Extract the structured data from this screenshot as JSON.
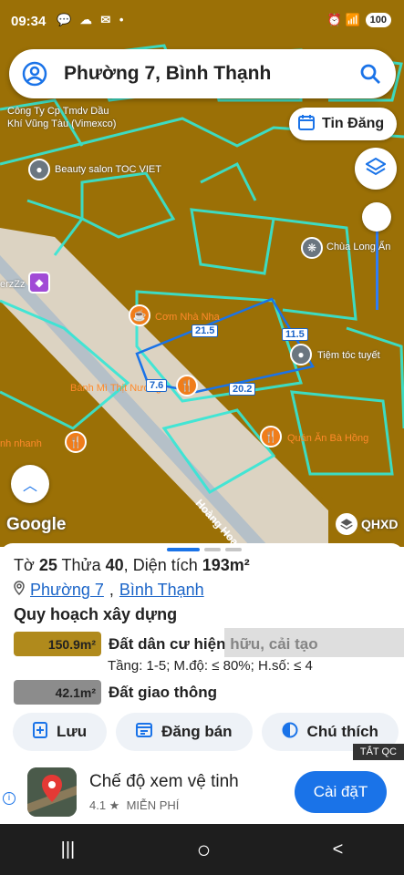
{
  "status": {
    "time": "09:34",
    "icons": "💬 ☁ ✉ •",
    "right_icons": "⏰ 📶",
    "battery": "100"
  },
  "search": {
    "title": "Phường 7, Bình Thạnh"
  },
  "map": {
    "tin_dang_label": "Tin Đăng",
    "pois": {
      "cong_ty_line1": "Công Ty Cp Tmdv Dầu",
      "cong_ty_line2": "Khí Vũng Tàu (Vimexco)",
      "beauty_salon": "Beauty salon TOC VIET",
      "chua_long_an": "Chùa Long Ẩn",
      "zerz": "erzZz",
      "com_nha": "Cơm Nhà Nha",
      "toc_tuyet": "Tiệm tóc tuyết",
      "banh_mi": "Bánh Mì Thịt Nướng",
      "nhanh": "nh nhanh",
      "quan_an": "Quán Ăn Bà Hồng"
    },
    "dimensions": {
      "d1": "21.5",
      "d2": "11.5",
      "d3": "20.2",
      "d4": "7.6"
    },
    "road_name": "Hoàng Hoa Thám",
    "google_logo": "Google",
    "qhxd_label": "QHXD"
  },
  "parcel": {
    "to_label": "Tờ",
    "to_value": "25",
    "thua_label": "Thửa",
    "thua_value": "40",
    "area_label": "Diện tích",
    "area_value": "193m²"
  },
  "place": {
    "ward": "Phường 7",
    "district": "Bình Thạnh",
    "separator": ","
  },
  "zoning": {
    "title": "Quy hoạch xây dựng",
    "zones": [
      {
        "area": "150.9m²",
        "label": "Đất dân cư hiện hữu, cải tạo",
        "color": "#b08a1c"
      },
      {
        "area": "42.1m²",
        "label": "Đất giao thông",
        "color": "#8c8c8c"
      }
    ],
    "detail": "Tầng: 1-5; M.độ: ≤ 80%; H.số: ≤ 4"
  },
  "actions": {
    "save": "Lưu",
    "sell": "Đăng bán",
    "legend": "Chú thích"
  },
  "ad": {
    "tag": "TẮT QC",
    "title": "Chế độ xem vệ tinh",
    "rating": "4.1 ★",
    "price": "MIỄN PHÍ",
    "cta": "Cài đặT"
  },
  "nav": {
    "recent": "|||",
    "home": "○",
    "back": "<"
  }
}
